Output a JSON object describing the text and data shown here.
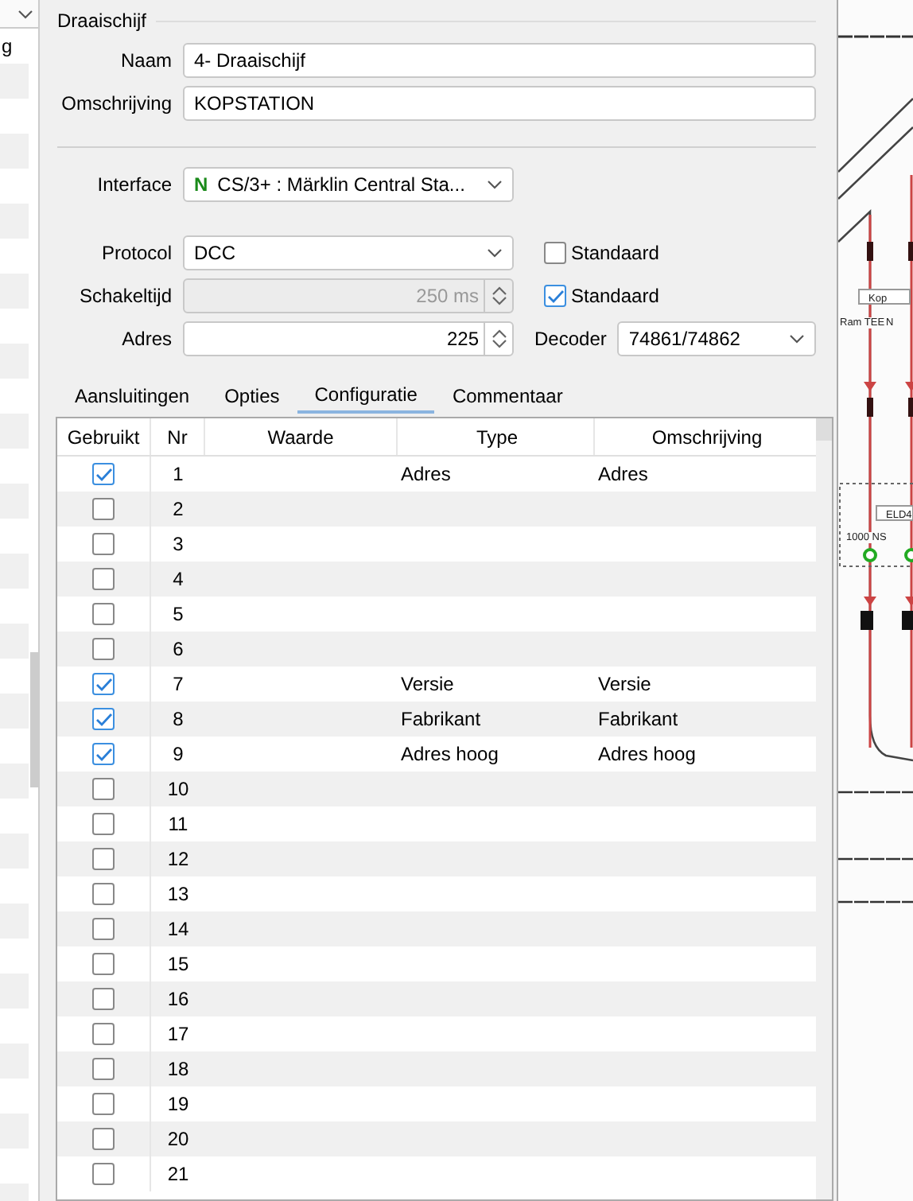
{
  "left_list": {
    "items": [
      "g"
    ]
  },
  "group": {
    "title": "Draaischijf"
  },
  "fields": [
    {
      "label": "Naam",
      "value": "4- Draaischijf"
    },
    {
      "label": "Omschrijving",
      "value": "KOPSTATION"
    }
  ],
  "interface": {
    "label": "Interface",
    "badge": "N",
    "value": "CS/3+ : Märklin Central Sta..."
  },
  "protocol": {
    "label": "Protocol",
    "value": "DCC",
    "default": {
      "label": "Standaard",
      "checked": false
    }
  },
  "switch_time": {
    "label": "Schakeltijd",
    "value": "250 ms",
    "disabled": true,
    "default": {
      "label": "Standaard",
      "checked": true
    }
  },
  "address": {
    "label": "Adres",
    "value": "225"
  },
  "decoder": {
    "label": "Decoder",
    "value": "74861/74862"
  },
  "tabs": [
    {
      "label": "Aansluitingen",
      "selected": false
    },
    {
      "label": "Opties",
      "selected": false
    },
    {
      "label": "Configuratie",
      "selected": true
    },
    {
      "label": "Commentaar",
      "selected": false
    }
  ],
  "table": {
    "columns": [
      "Gebruikt",
      "Nr",
      "Waarde",
      "Type",
      "Omschrijving"
    ],
    "rows": [
      {
        "used": true,
        "nr": "1",
        "type": "Adres",
        "description": "Adres"
      },
      {
        "used": false,
        "nr": "2"
      },
      {
        "used": false,
        "nr": "3"
      },
      {
        "used": false,
        "nr": "4"
      },
      {
        "used": false,
        "nr": "5"
      },
      {
        "used": false,
        "nr": "6"
      },
      {
        "used": true,
        "nr": "7",
        "type": "Versie",
        "description": "Versie"
      },
      {
        "used": true,
        "nr": "8",
        "type": "Fabrikant",
        "description": "Fabrikant"
      },
      {
        "used": true,
        "nr": "9",
        "type": "Adres hoog",
        "description": "Adres hoog"
      },
      {
        "used": false,
        "nr": "10"
      },
      {
        "used": false,
        "nr": "11"
      },
      {
        "used": false,
        "nr": "12"
      },
      {
        "used": false,
        "nr": "13"
      },
      {
        "used": false,
        "nr": "14"
      },
      {
        "used": false,
        "nr": "15"
      },
      {
        "used": false,
        "nr": "16"
      },
      {
        "used": false,
        "nr": "17"
      },
      {
        "used": false,
        "nr": "18"
      },
      {
        "used": false,
        "nr": "19"
      },
      {
        "used": false,
        "nr": "20"
      },
      {
        "used": false,
        "nr": "21"
      }
    ]
  },
  "canvas": {
    "labels": [
      {
        "kind": "box",
        "text": "Kop"
      },
      {
        "kind": "plain",
        "text": "Ram TEE"
      },
      {
        "kind": "plain",
        "text": "N"
      },
      {
        "kind": "box",
        "text": "ELD4"
      },
      {
        "kind": "plain",
        "text": "1000 NS"
      }
    ]
  }
}
